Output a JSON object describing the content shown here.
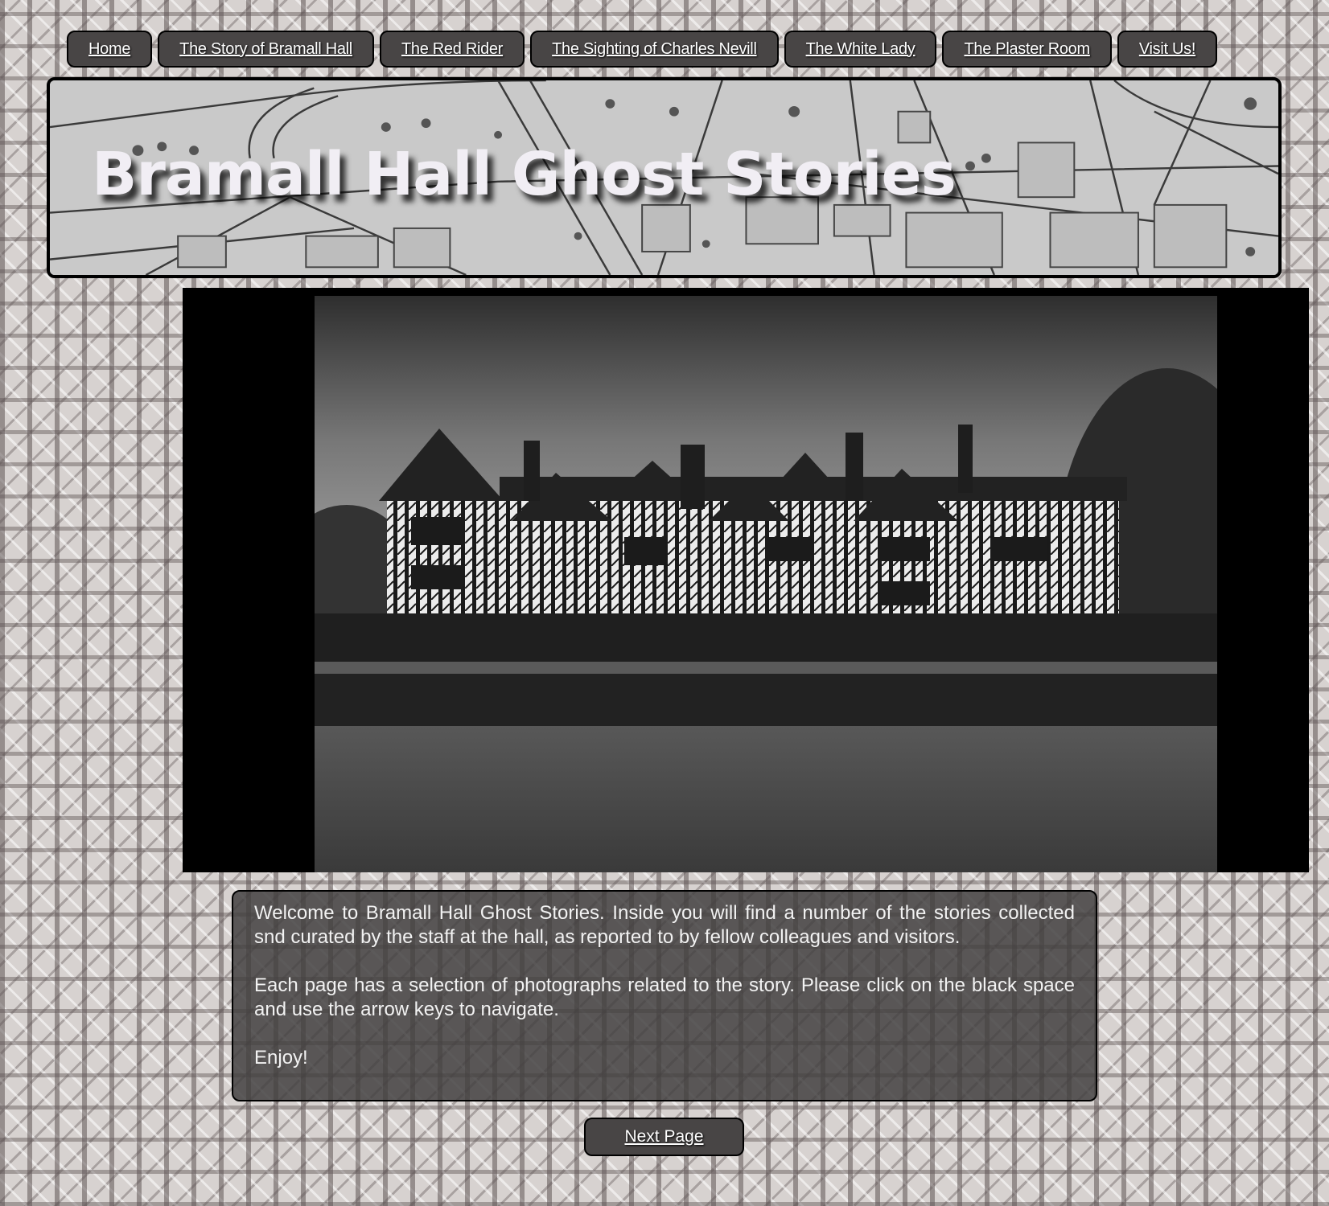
{
  "nav": {
    "items": [
      {
        "label": "Home"
      },
      {
        "label": "The Story of Bramall Hall"
      },
      {
        "label": "The Red Rider"
      },
      {
        "label": "The Sighting of Charles Nevill"
      },
      {
        "label": "The White Lady"
      },
      {
        "label": "The Plaster Room"
      },
      {
        "label": "Visit Us!"
      }
    ]
  },
  "header": {
    "title": "Bramall Hall Ghost Stories"
  },
  "intro": {
    "paragraphs": [
      "Welcome to Bramall Hall Ghost Stories. Inside you will find a number of the stories collected snd curated by the staff at the hall, as reported to by fellow colleagues and visitors.",
      "Each page has a selection of photographs related to the story. Please click on the black space and use the arrow keys to navigate.",
      "Enjoy!"
    ]
  },
  "footer": {
    "next_label": "Next Page"
  },
  "colors": {
    "button_bg": "#484545",
    "slideshow_bg": "#000000",
    "title_color": "#f1eef4"
  }
}
